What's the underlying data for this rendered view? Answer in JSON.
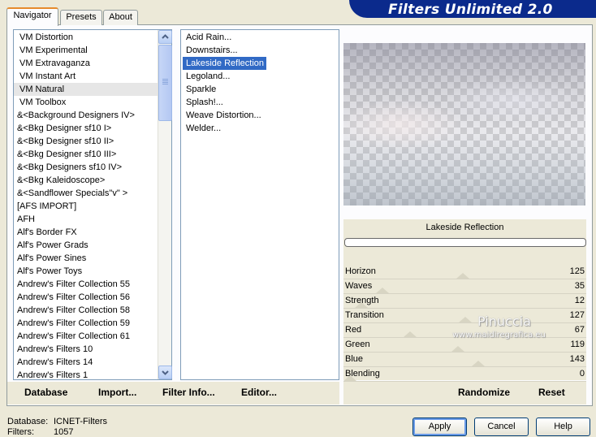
{
  "app": {
    "title": "Filters Unlimited 2.0"
  },
  "tabs": [
    {
      "label": "Navigator"
    },
    {
      "label": "Presets"
    },
    {
      "label": "About"
    }
  ],
  "categories": {
    "items": [
      "VM Distortion",
      "VM Experimental",
      "VM Extravaganza",
      "VM Instant Art",
      "VM Natural",
      "VM Toolbox",
      "&<Background Designers IV>",
      "&<Bkg Designer sf10 I>",
      "&<Bkg Designer sf10 II>",
      "&<Bkg Designer sf10 III>",
      "&<Bkg Designers sf10 IV>",
      "&<Bkg Kaleidoscope>",
      "&<Sandflower Specials\"v\" >",
      "[AFS IMPORT]",
      "AFH",
      "Alf's Border FX",
      "Alf's Power Grads",
      "Alf's Power Sines",
      "Alf's Power Toys",
      "Andrew's Filter Collection 55",
      "Andrew's Filter Collection 56",
      "Andrew's Filter Collection 58",
      "Andrew's Filter Collection 59",
      "Andrew's Filter Collection 61",
      "Andrew's Filters 10",
      "Andrew's Filters 14",
      "Andrew's Filters 1"
    ],
    "selected_index": 4
  },
  "filters": {
    "items": [
      "Acid Rain...",
      "Downstairs...",
      "Lakeside Reflection",
      "Legoland...",
      "Sparkle",
      "Splash!...",
      "Weave Distortion...",
      "Welder..."
    ],
    "selected_index": 2
  },
  "preview": {
    "filter_name": "Lakeside Reflection"
  },
  "parameters": [
    {
      "label": "Horizon",
      "value": "125",
      "fraction": 0.49
    },
    {
      "label": "Waves",
      "value": "35",
      "fraction": 0.14
    },
    {
      "label": "Strength",
      "value": "12",
      "fraction": 0.05
    },
    {
      "label": "Transition",
      "value": "127",
      "fraction": 0.5
    },
    {
      "label": "Red",
      "value": "67",
      "fraction": 0.26
    },
    {
      "label": "Green",
      "value": "119",
      "fraction": 0.47
    },
    {
      "label": "Blue",
      "value": "143",
      "fraction": 0.56
    },
    {
      "label": "Blending",
      "value": "0",
      "fraction": 0.0
    }
  ],
  "watermark": {
    "name": "Pinuccia",
    "site": "www.maidiregrafica.eu"
  },
  "left_commands": {
    "database": "Database",
    "import": "Import...",
    "filter_info": "Filter Info...",
    "editor": "Editor..."
  },
  "right_commands": {
    "randomize": "Randomize",
    "reset": "Reset"
  },
  "footer": {
    "database_label": "Database:",
    "database_value": "ICNET-Filters",
    "filters_label": "Filters:",
    "filters_value": "1057"
  },
  "buttons": {
    "apply": "Apply",
    "cancel": "Cancel",
    "help": "Help"
  }
}
